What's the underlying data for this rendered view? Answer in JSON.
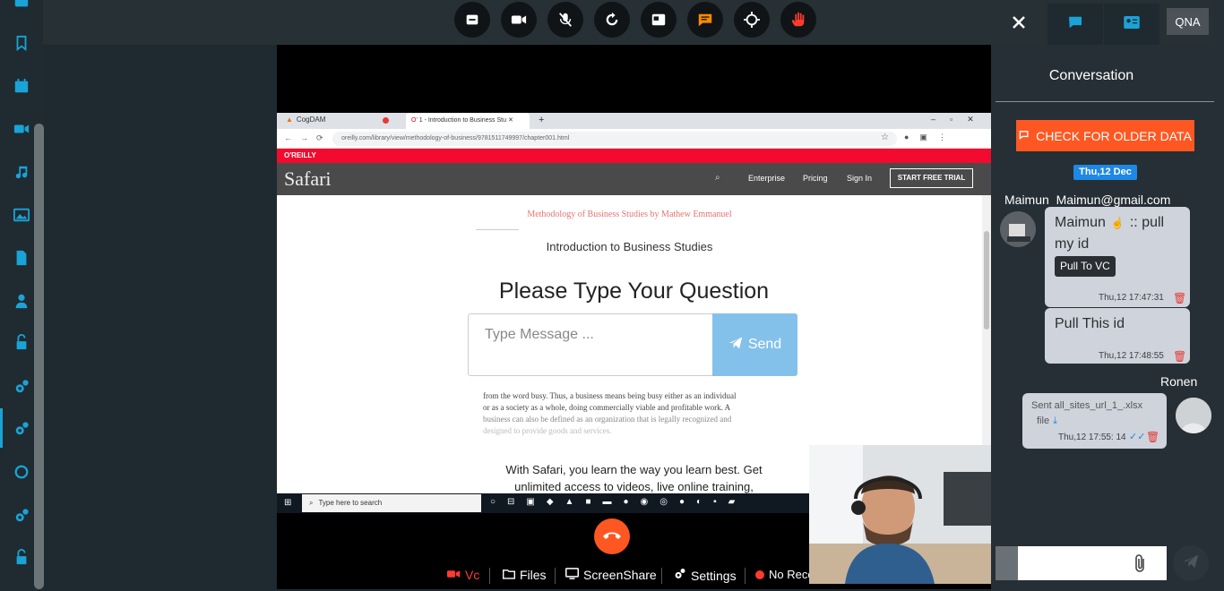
{
  "topbar": {
    "controls": [
      {
        "icon": "screen-icon",
        "color": "#ffffff"
      },
      {
        "icon": "camera-icon",
        "color": "#ffffff"
      },
      {
        "icon": "mic-off-icon",
        "color": "#ffffff"
      },
      {
        "icon": "refresh-icon",
        "color": "#ffffff"
      },
      {
        "icon": "window-icon",
        "color": "#ffffff"
      },
      {
        "icon": "chat-icon",
        "color": "#ff8a00"
      },
      {
        "icon": "target-icon",
        "color": "#ffffff"
      },
      {
        "icon": "hand-icon",
        "color": "#ff3b30"
      }
    ]
  },
  "browser": {
    "tab1": "CogDAM",
    "tab2": "1 - Introduction to Business Stu",
    "url": "oreilly.com/library/view/methodology-of-business/9781511749997/chapter001.html",
    "brand": "O'REILLY",
    "site": "Safari",
    "nav": [
      "Enterprise",
      "Pricing",
      "Sign In"
    ],
    "cta": "START FREE TRIAL",
    "book": "Methodology of Business Studies by Mathew Emmanuel",
    "chapter": "Introduction to Business Studies",
    "body1": "from the word busy. Thus, a business means being busy either as an individual",
    "body2": "or as a society as a whole, doing commercially viable and profitable work. A",
    "body3": "business can also be defined as an organization that is legally recognized and",
    "body4": "designed to provide goods and services.",
    "promo1": "With Safari, you learn the way you learn best. Get",
    "promo2": "unlimited access to videos, live online training,",
    "taskbar_search": "Type here to search"
  },
  "question": {
    "title": "Please Type Your Question",
    "placeholder": "Type Message ...",
    "send": "Send"
  },
  "bottombar": {
    "vc": "Vc",
    "files": "Files",
    "screenshare": "ScreenShare",
    "settings": "Settings",
    "record": "No Reco"
  },
  "panel": {
    "qna": "QNA",
    "title": "Conversation",
    "older_button": "CHECK FOR OLDER DATA",
    "date": "Thu,12 Dec",
    "sender1": "Maimun  Maimun@gmail.com",
    "msg1_name": "Maimun",
    "msg1_text_a": ":: pull",
    "msg1_text_b": "my id",
    "msg1_pill": "Pull To VC",
    "msg1_time": "Thu,12 17:47:31",
    "msg2_text": "Pull This id",
    "msg2_time": "Thu,12 17:48:55",
    "sender2": "Ronen",
    "msg3_text_a": "Sent all_sites_url_1_.xlsx",
    "msg3_text_b": "file",
    "msg3_time": "Thu,12 17:55: 14"
  },
  "colors": {
    "accent": "#1aa3d6",
    "orange_button": "#ff5722",
    "date_badge": "#1e88e5",
    "send_button": "#84c1ea",
    "hangup": "#ff5722"
  }
}
